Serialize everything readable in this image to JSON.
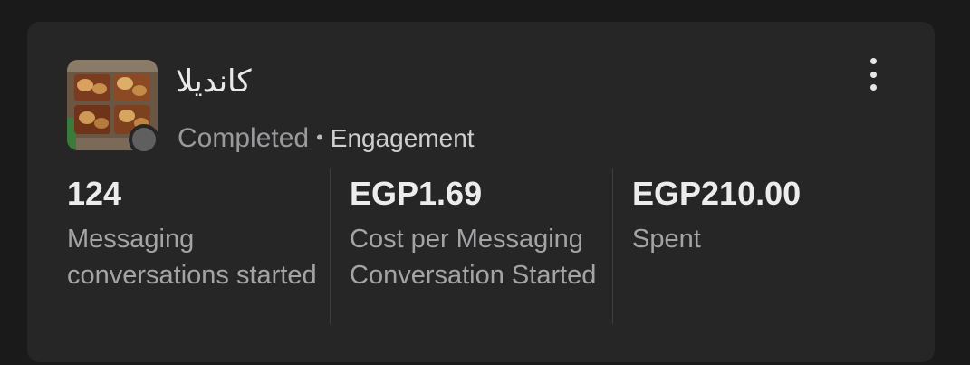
{
  "campaign": {
    "name": "كانديلا",
    "status": "Completed",
    "separator": "•",
    "objective": "Engagement",
    "status_color": "#5f5f60"
  },
  "metrics": [
    {
      "value": "124",
      "label": "Messaging conversations started"
    },
    {
      "value": "EGP1.69",
      "label": "Cost per Messaging Conversation Started"
    },
    {
      "value": "EGP210.00",
      "label": "Spent"
    }
  ],
  "icons": {
    "more": "vertical-ellipsis",
    "status": "status-dot"
  },
  "colors": {
    "background": "#1a1a1b",
    "card": "#262627",
    "primary_text": "#ececed",
    "secondary_text": "#a4a4a6"
  }
}
